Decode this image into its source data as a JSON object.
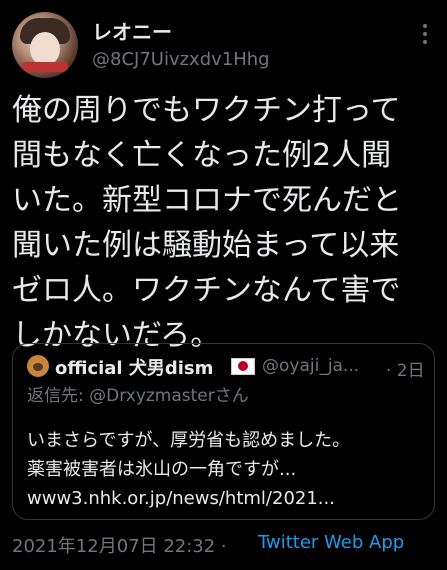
{
  "tweet": {
    "author_name": "レオニー",
    "author_handle": "@8CJ7Uivzxdv1Hhg",
    "text": "俺の周りでもワクチン打って\n間もなく亡くなった例2人聞\nいた。新型コロナで死んだと\n聞いた例は騒動始まって以来\nゼロ人。ワクチンなんて害で\nしかないだろ。",
    "timestamp": "2021年12月07日 22:32 · ",
    "source": "Twitter Web App"
  },
  "quote": {
    "author_name": "official 犬男dism",
    "author_handle": "@oyaji_ja...",
    "time": "· 2日",
    "reply_to": "返信先: @Drxyzmasterさん",
    "text": "いまさらですが、厚労省も認めました。\n薬害被害者は氷山の一角ですが...\nwww3.nhk.or.jp/news/html/2021..."
  },
  "colors": {
    "background": "#000000",
    "text": "#e7e9ea",
    "secondary": "#71767b",
    "link": "#1d9bf0"
  }
}
